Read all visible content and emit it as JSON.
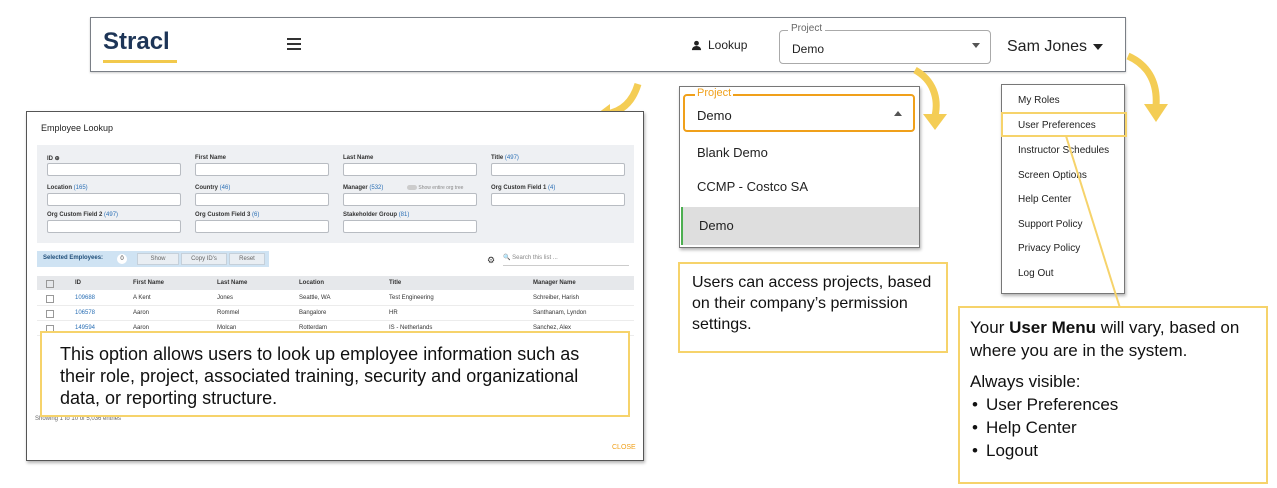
{
  "topbar": {
    "logo": "Stracl",
    "lookup_label": "Lookup",
    "project_label": "Project",
    "project_value": "Demo",
    "user_name": "Sam Jones"
  },
  "lookup_window": {
    "title": "Employee Lookup",
    "fields": {
      "id": {
        "label": "ID ⊕"
      },
      "first_name": {
        "label": "First Name"
      },
      "last_name": {
        "label": "Last Name"
      },
      "title": {
        "label": "Title",
        "count": "(497)"
      },
      "location": {
        "label": "Location",
        "count": "(165)"
      },
      "country": {
        "label": "Country",
        "count": "(46)"
      },
      "manager": {
        "label": "Manager",
        "count": "(532)"
      },
      "manager_toggle": "Show entire org tree",
      "org_custom_1": {
        "label": "Org Custom Field 1",
        "count": "(4)"
      },
      "org_custom_2": {
        "label": "Org Custom Field 2",
        "count": "(497)"
      },
      "org_custom_3": {
        "label": "Org Custom Field 3",
        "count": "(6)"
      },
      "stakeholder": {
        "label": "Stakeholder Group",
        "count": "(81)"
      }
    },
    "selected_label": "Selected Employees:",
    "selected_count": "0",
    "btn_show": "Show",
    "btn_copy": "Copy ID's",
    "btn_reset": "Reset",
    "search_placeholder": "Search this list ...",
    "columns": [
      "ID",
      "First Name",
      "Last Name",
      "Location",
      "Title",
      "Manager Name"
    ],
    "rows": [
      [
        "109688",
        "A Kent",
        "Jones",
        "Seattle, WA",
        "Test Engineering",
        "Schreiber, Harish"
      ],
      [
        "106578",
        "Aaron",
        "Rommel",
        "Bangalore",
        "HR",
        "Santhanam, Lyndon"
      ],
      [
        "149594",
        "Aaron",
        "Molcan",
        "Rotterdam",
        "IS - Netherlands",
        "Sanchez, Alex"
      ]
    ],
    "showing": "Showing 1 to 10 of 5,036 entries",
    "close": "CLOSE"
  },
  "callouts": {
    "lookup": "This option allows users to look up employee information such as their role, project, associated training, security and organizational data, or reporting structure.",
    "projects": "Users can access projects, based on their company’s permission settings.",
    "user_menu_pre": "Your ",
    "user_menu_bold": "User Menu",
    "user_menu_post": " will vary, based on where you are in the system.",
    "always_visible": "Always visible:",
    "bullets": [
      "User Preferences",
      "Help Center",
      "Logout"
    ]
  },
  "project_dropdown": {
    "label": "Project",
    "value": "Demo",
    "options": [
      "Blank Demo",
      "CCMP - Costco SA",
      "Demo"
    ]
  },
  "user_menu": {
    "items": [
      "My Roles",
      "User Preferences",
      "Instructor Schedules",
      "Screen Options",
      "Help Center",
      "Support Policy",
      "Privacy Policy",
      "Log Out"
    ]
  },
  "colors": {
    "accent_yellow": "#f6d36b",
    "arrow_yellow": "#f4cd55",
    "brand_navy": "#1d3557",
    "orange": "#f0a01a",
    "link_blue": "#2a6fb5"
  }
}
